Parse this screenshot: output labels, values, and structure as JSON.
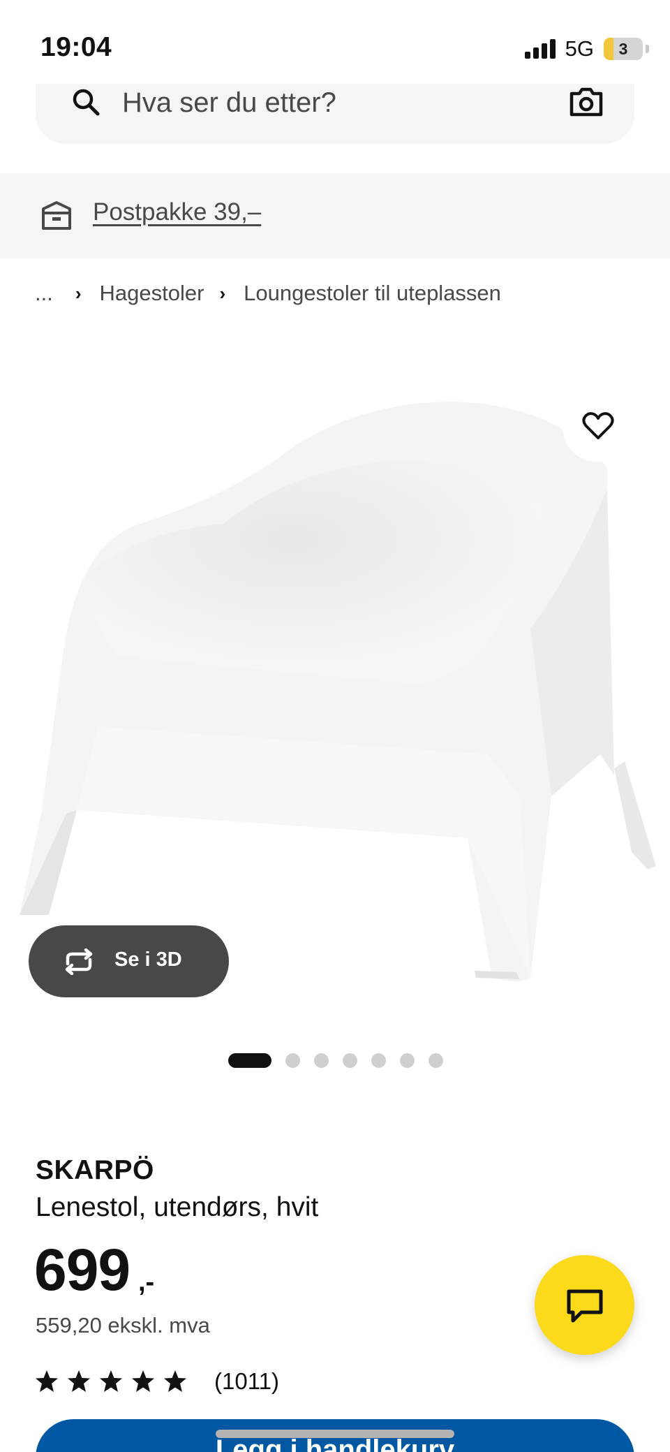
{
  "status_bar": {
    "time": "19:04",
    "network": "5G",
    "battery_level": "3",
    "battery_fill_percent": 25
  },
  "search": {
    "placeholder": "Hva ser du etter?"
  },
  "shipping": {
    "label": "Postpakke 39,–"
  },
  "breadcrumb": {
    "ellipsis": "...",
    "items": [
      "Hagestoler",
      "Loungestoler til uteplassen"
    ]
  },
  "gallery": {
    "view_3d_label": "Se i 3D",
    "total_images": 7,
    "active_index": 0
  },
  "product": {
    "name": "SKARPÖ",
    "description": "Lenestol, utendørs, hvit",
    "price": "699",
    "price_suffix": ",-",
    "price_excl_vat": "559,20 ekskl. mva",
    "rating_stars": 5,
    "rating_count": "(1011)"
  },
  "cart": {
    "label": "Legg i handlekurv"
  },
  "colors": {
    "accent_blue": "#0058a3",
    "chat_yellow": "#fada1a",
    "dark_button": "#484848"
  }
}
